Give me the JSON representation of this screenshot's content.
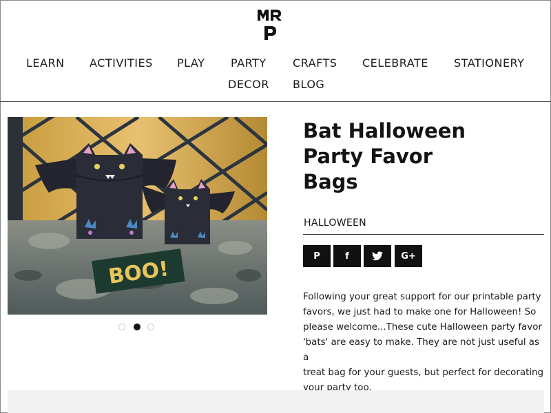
{
  "logo": {
    "text": "MRP"
  },
  "nav": {
    "items": [
      "LEARN",
      "ACTIVITIES",
      "PLAY",
      "PARTY",
      "CRAFTS",
      "CELEBRATE",
      "STATIONERY",
      "DECOR",
      "BLOG"
    ]
  },
  "hero": {
    "sign_text": "BOO!",
    "carousel": {
      "count": 3,
      "active_index": 1
    }
  },
  "article": {
    "title_lines": [
      "Bat Halloween",
      "Party Favor",
      "Bags"
    ],
    "category": "HALLOWEEN",
    "share": [
      {
        "icon": "pinterest-icon",
        "glyph": "P"
      },
      {
        "icon": "facebook-icon",
        "glyph": "f"
      },
      {
        "icon": "twitter-icon",
        "glyph": "t"
      },
      {
        "icon": "google-plus-icon",
        "glyph": "G+"
      }
    ],
    "description_lines": [
      "Following your great support for our printable party",
      "favors, we just had to make one for Halloween! So",
      "please welcome...These cute Halloween party favor",
      "'bats' are easy to make. They are not just useful as a",
      "treat bag for your guests, but perfect for decorating",
      "your party too."
    ]
  },
  "colors": {
    "accent": "#111111",
    "divider": "#555555",
    "footer_band": "#f2f2f2"
  }
}
